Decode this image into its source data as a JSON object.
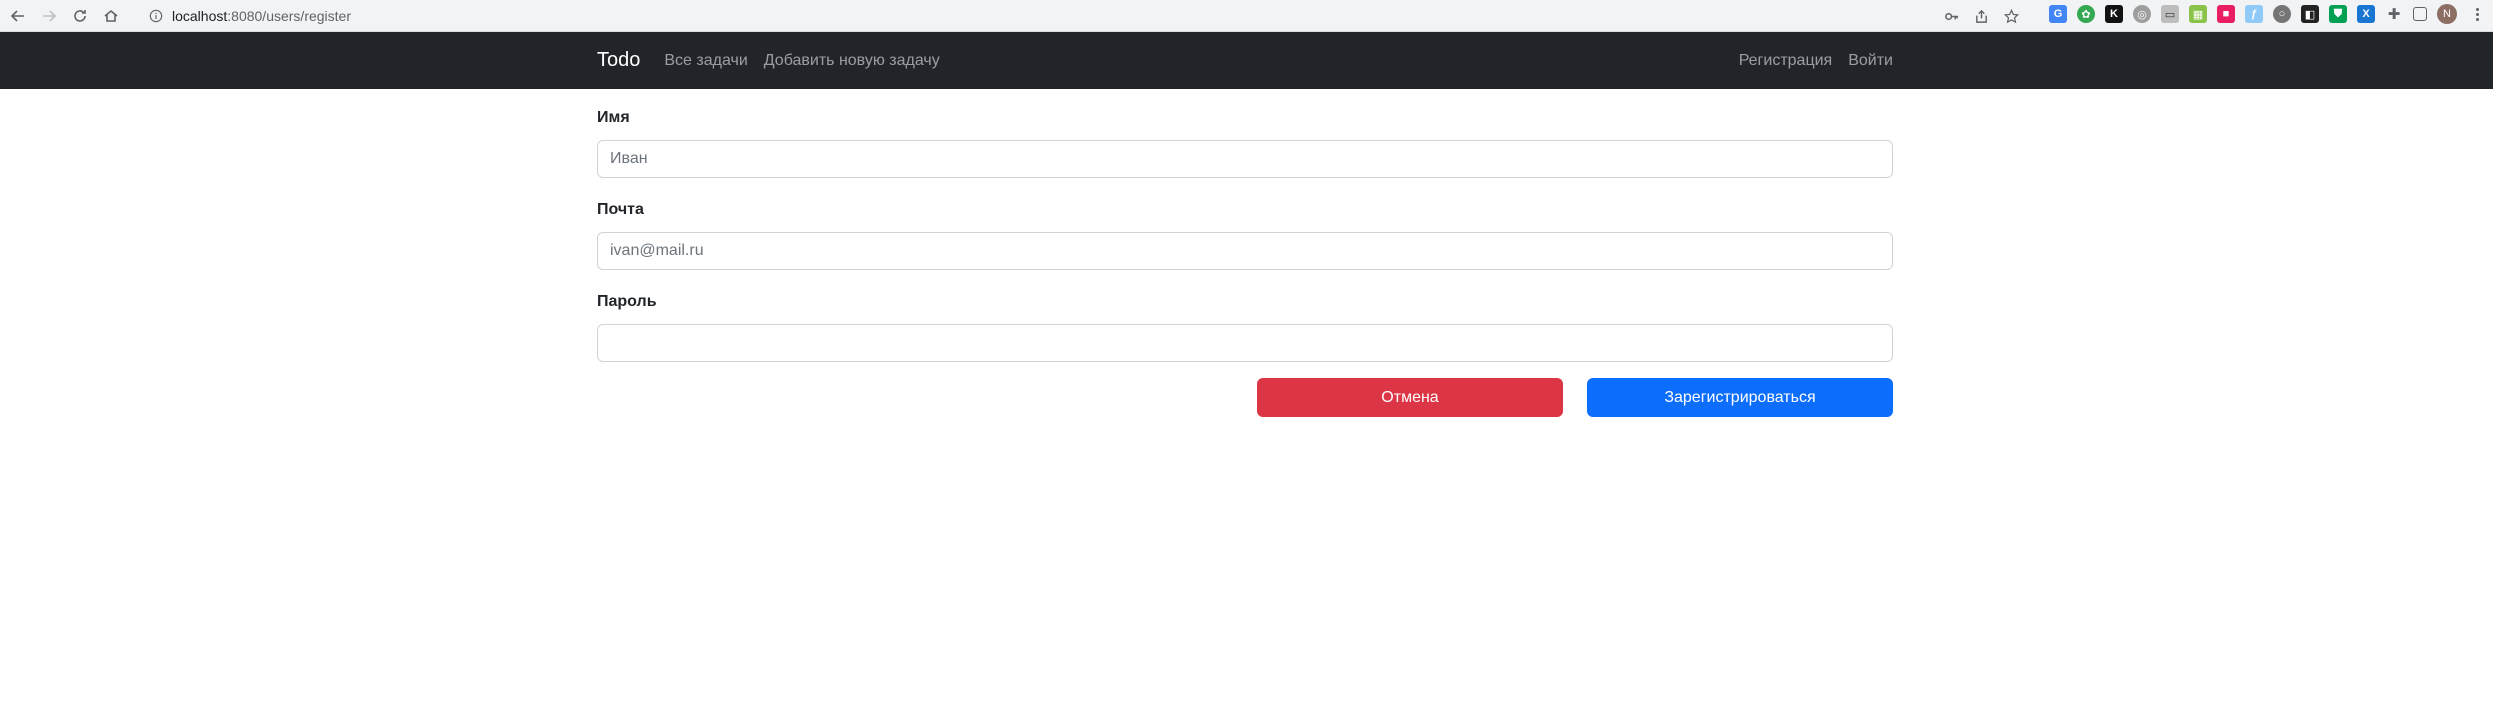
{
  "browser": {
    "url_host": "localhost",
    "url_path": ":8080/users/register",
    "profile_initial": "N"
  },
  "navbar": {
    "brand": "Todo",
    "links": [
      "Все задачи",
      "Добавить новую задачу"
    ],
    "right_links": [
      "Регистрация",
      "Войти"
    ]
  },
  "form": {
    "name_label": "Имя",
    "name_placeholder": "Иван",
    "email_label": "Почта",
    "email_placeholder": "ivan@mail.ru",
    "password_label": "Пароль",
    "password_placeholder": "",
    "cancel_label": "Отмена",
    "submit_label": "Зарегистрироваться"
  },
  "colors": {
    "navbar_bg": "#212529",
    "cancel": "#dc3545",
    "submit": "#0d6efd"
  }
}
